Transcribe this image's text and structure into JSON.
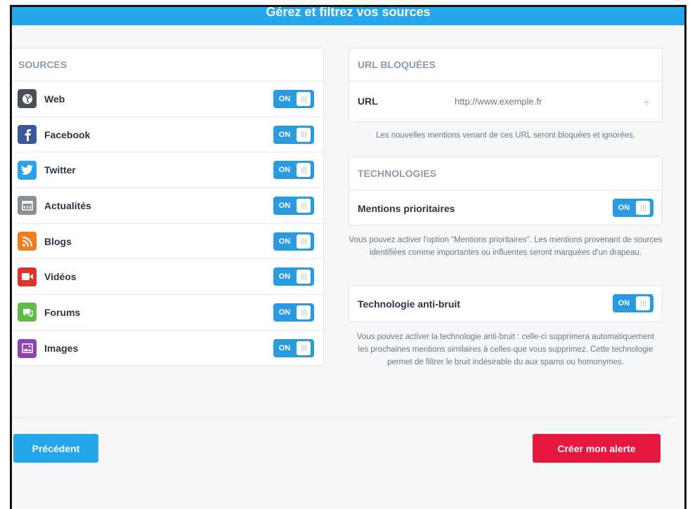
{
  "header": {
    "title": "Gérez et filtrez vos sources"
  },
  "sources": {
    "title": "SOURCES",
    "toggle_label": "ON",
    "items": [
      {
        "label": "Web",
        "icon": "globe-icon",
        "color": "#4a4f55"
      },
      {
        "label": "Facebook",
        "icon": "facebook-icon",
        "color": "#3b5998"
      },
      {
        "label": "Twitter",
        "icon": "twitter-icon",
        "color": "#2aa3ef"
      },
      {
        "label": "Actualités",
        "icon": "news-icon",
        "color": "#8a8f94"
      },
      {
        "label": "Blogs",
        "icon": "rss-icon",
        "color": "#f47c20"
      },
      {
        "label": "Vidéos",
        "icon": "video-icon",
        "color": "#e0322a"
      },
      {
        "label": "Forums",
        "icon": "forum-icon",
        "color": "#62bb46"
      },
      {
        "label": "Images",
        "icon": "image-icon",
        "color": "#8e44ad"
      }
    ]
  },
  "blocked": {
    "title": "URL BLOQUÉES",
    "url_label": "URL",
    "url_placeholder": "http://www.exemple.fr",
    "help": "Les nouvelles mentions venant de ces URL seront bloquées et ignorées."
  },
  "technologies": {
    "title": "TECHNOLOGIES",
    "priority_label": "Mentions prioritaires",
    "priority_help": "Vous pouvez activer l'option \"Mentions prioritaires\". Les mentions provenant de sources identifiées comme importantes ou influentes seront marquées d'un drapeau.",
    "antinoise_label": "Technologie anti-bruit",
    "antinoise_help": "Vous pouvez activer la technologie anti-bruit : celle-ci supprimera automatiquement les prochaines mentions similaires à celles-que vous supprimez. Cette technologie permet de filtrer le bruit indésirable du aux spams ou homonymes.",
    "toggle_label": "ON"
  },
  "actions": {
    "prev": "Précédent",
    "create": "Créer mon alerte"
  },
  "colors": {
    "accent": "#23a7ea",
    "toggle": "#2a9be0",
    "danger": "#e8173f"
  }
}
